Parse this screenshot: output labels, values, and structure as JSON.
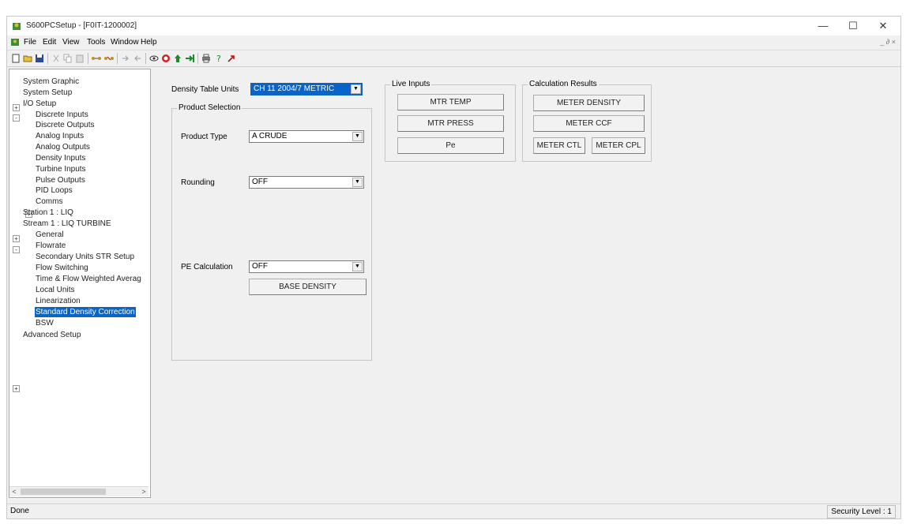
{
  "window": {
    "title": "S600PCSetup - [F0IT-1200002]",
    "minimize_glyph": "—",
    "maximize_glyph": "☐",
    "close_glyph": "✕"
  },
  "menubar": {
    "items": [
      "File",
      "Edit",
      "View",
      "Tools",
      "Window",
      "Help"
    ],
    "mdi_controls": "_ ∂ ×"
  },
  "toolbar": {
    "buttons": [
      "new-icon",
      "open-icon",
      "save-icon",
      "cut-icon",
      "copy-icon",
      "paste-icon",
      "connect-icon",
      "disconnect-icon",
      "send-icon",
      "receive-icon",
      "eye-icon",
      "stop-icon",
      "upload-icon",
      "download-icon",
      "print-icon",
      "help-icon",
      "arrow-icon"
    ]
  },
  "tree": {
    "items": [
      {
        "label": "System Graphic",
        "level": 0,
        "expander": ""
      },
      {
        "label": "System Setup",
        "level": 0,
        "expander": "+"
      },
      {
        "label": "I/O Setup",
        "level": 0,
        "expander": "-"
      },
      {
        "label": "Discrete Inputs",
        "level": 1,
        "expander": ""
      },
      {
        "label": "Discrete Outputs",
        "level": 1,
        "expander": ""
      },
      {
        "label": "Analog Inputs",
        "level": 1,
        "expander": ""
      },
      {
        "label": "Analog Outputs",
        "level": 1,
        "expander": ""
      },
      {
        "label": "Density Inputs",
        "level": 1,
        "expander": ""
      },
      {
        "label": "Turbine Inputs",
        "level": 1,
        "expander": ""
      },
      {
        "label": "Pulse Outputs",
        "level": 1,
        "expander": ""
      },
      {
        "label": "PID Loops",
        "level": 1,
        "expander": "+"
      },
      {
        "label": "Comms",
        "level": 1,
        "expander": ""
      },
      {
        "label": "Station 1 : LIQ",
        "level": 0,
        "expander": "+"
      },
      {
        "label": "Stream 1 : LIQ TURBINE",
        "level": 0,
        "expander": "-"
      },
      {
        "label": "General",
        "level": 1,
        "expander": ""
      },
      {
        "label": "Flowrate",
        "level": 1,
        "expander": ""
      },
      {
        "label": "Secondary Units STR Setup",
        "level": 1,
        "expander": ""
      },
      {
        "label": "Flow Switching",
        "level": 1,
        "expander": ""
      },
      {
        "label": "Time & Flow Weighted Averag",
        "level": 1,
        "expander": ""
      },
      {
        "label": "Local Units",
        "level": 1,
        "expander": ""
      },
      {
        "label": "Linearization",
        "level": 1,
        "expander": ""
      },
      {
        "label": "Standard Density Correction",
        "level": 1,
        "expander": "",
        "selected": true
      },
      {
        "label": "BSW",
        "level": 1,
        "expander": ""
      },
      {
        "label": "Advanced Setup",
        "level": 0,
        "expander": "+"
      }
    ],
    "scroll_left": "<",
    "scroll_right": ">"
  },
  "form": {
    "density_table_label": "Density Table Units",
    "density_table_value": "CH 11 2004/7 METRIC",
    "product_selection_title": "Product Selection",
    "product_type_label": "Product Type",
    "product_type_value": "A CRUDE",
    "rounding_label": "Rounding",
    "rounding_value": "OFF",
    "pe_calc_label": "PE Calculation",
    "pe_calc_value": "OFF",
    "base_density_button": "BASE DENSITY",
    "dropdown_glyph": "▼"
  },
  "live_inputs": {
    "title": "Live Inputs",
    "buttons": [
      "MTR TEMP",
      "MTR PRESS",
      "Pe"
    ]
  },
  "calc_results": {
    "title": "Calculation Results",
    "meter_density": "METER DENSITY",
    "meter_ccf": "METER CCF",
    "meter_ctl": "METER CTL",
    "meter_cpl": "METER CPL"
  },
  "status": {
    "text": "Done",
    "security": "Security Level : 1"
  }
}
